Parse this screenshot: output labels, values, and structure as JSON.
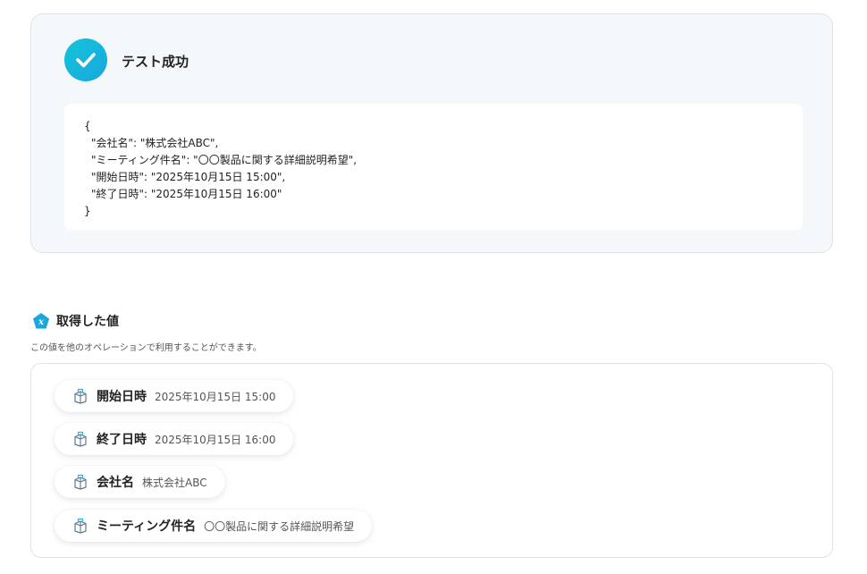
{
  "test_result": {
    "title": "テスト成功",
    "json_lines": [
      "{",
      "\"会社名\": \"株式会社ABC\",",
      "\"ミーティング件名\": \"〇〇製品に関する詳細説明希望\",",
      "\"開始日時\": \"2025年10月15日 15:00\",",
      "\"終了日時\": \"2025年10月15日 16:00\"",
      "}"
    ]
  },
  "acquired": {
    "title": "取得した値",
    "description": "この値を他のオペレーションで利用することができます。",
    "items": [
      {
        "label": "開始日時",
        "value": "2025年10月15日 15:00"
      },
      {
        "label": "終了日時",
        "value": "2025年10月15日 16:00"
      },
      {
        "label": "会社名",
        "value": "株式会社ABC"
      },
      {
        "label": "ミーティング件名",
        "value": "〇〇製品に関する詳細説明希望"
      }
    ]
  },
  "colors": {
    "accent": "#1aa6de",
    "accent_light": "#12c6d8",
    "card_bg": "#f5f8fb"
  },
  "icons": {
    "success": "check-icon",
    "variable": "variable-x-icon",
    "item": "box-icon"
  }
}
